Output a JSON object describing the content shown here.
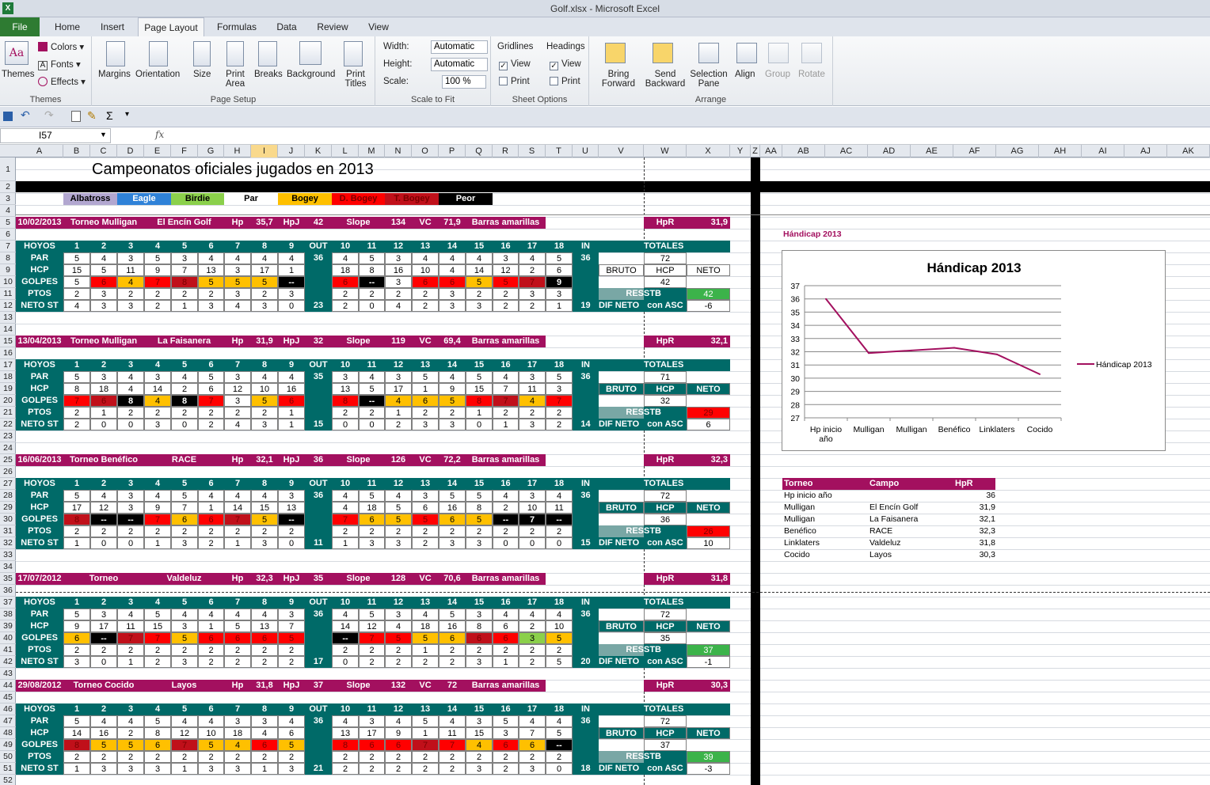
{
  "window": {
    "title": "Golf.xlsx  -  Microsoft Excel",
    "app_icon": "excel-icon"
  },
  "tabs": [
    "File",
    "Home",
    "Insert",
    "Page Layout",
    "Formulas",
    "Data",
    "Review",
    "View"
  ],
  "active_tab": "Page Layout",
  "ribbon": {
    "themes": {
      "label": "Themes",
      "colors": "Colors",
      "fonts": "Fonts",
      "effects": "Effects",
      "group": "Themes"
    },
    "page_setup": {
      "margins": "Margins",
      "orientation": "Orientation",
      "size": "Size",
      "print_area": "Print Area",
      "breaks": "Breaks",
      "background": "Background",
      "print_titles": "Print Titles",
      "group": "Page Setup"
    },
    "scale": {
      "width_label": "Width:",
      "width_value": "Automatic",
      "height_label": "Height:",
      "height_value": "Automatic",
      "scale_label": "Scale:",
      "scale_value": "100 %",
      "group": "Scale to Fit"
    },
    "sheet_options": {
      "gridlines": "Gridlines",
      "headings": "Headings",
      "view": "View",
      "print": "Print",
      "group": "Sheet Options"
    },
    "arrange": {
      "bring_forward": "Bring Forward",
      "send_backward": "Send Backward",
      "selection_pane": "Selection Pane",
      "align": "Align",
      "group_btn": "Group",
      "rotate": "Rotate",
      "group": "Arrange"
    }
  },
  "formula_bar": {
    "name_box": "I57",
    "fx": "fx",
    "formula": ""
  },
  "columns": [
    "A",
    "B",
    "C",
    "D",
    "E",
    "F",
    "G",
    "H",
    "I",
    "J",
    "K",
    "L",
    "M",
    "N",
    "O",
    "P",
    "Q",
    "R",
    "S",
    "T",
    "U",
    "V",
    "W",
    "X",
    "Y",
    "Z",
    "AA",
    "AB",
    "AC",
    "AD",
    "AE",
    "AF",
    "AG",
    "AH",
    "AI",
    "AJ",
    "AK"
  ],
  "selected_column": "I",
  "sheet": {
    "title": "Campeonatos oficiales jugados en 2013",
    "legend": [
      "Albatross",
      "Eagle",
      "Birdie",
      "Par",
      "Bogey",
      "D. Bogey",
      "T. Bogey",
      "Peor"
    ],
    "legend_colors": [
      "#b2a7d0",
      "#2f82d8",
      "#8bd04b",
      "#ffffff",
      "#ffc000",
      "#ff0000",
      "#c0101a",
      "#000000"
    ],
    "holes": [
      "1",
      "2",
      "3",
      "4",
      "5",
      "6",
      "7",
      "8",
      "9",
      "OUT",
      "10",
      "11",
      "12",
      "13",
      "14",
      "15",
      "16",
      "17",
      "18",
      "IN"
    ],
    "labels": {
      "hoyos": "HOYOS",
      "par": "PAR",
      "hcp": "HCP",
      "golpes": "GOLPES",
      "ptos": "PTOS",
      "neto": "NETO ST",
      "totales": "TOTALES",
      "bruto": "BRUTO",
      "hcp2": "HCP",
      "neto2": "NETO",
      "res": "RES",
      "stb": "STB",
      "dif": "DIF NETO",
      "asc": "con ASC",
      "hpr": "HpR",
      "hp": "Hp",
      "hpj": "HpJ",
      "slope": "Slope",
      "vc": "VC"
    },
    "rounds": [
      {
        "date": "10/02/2013",
        "event": "Torneo Mulligan",
        "course": "El Encín Golf",
        "hp": "35,7",
        "hpj": "42",
        "slope": "134",
        "vc": "71,9",
        "tees": "Barras amarillas",
        "hpr": "31,9",
        "par": [
          "5",
          "4",
          "3",
          "5",
          "3",
          "4",
          "4",
          "4",
          "4",
          "36",
          "4",
          "5",
          "3",
          "4",
          "4",
          "4",
          "3",
          "4",
          "5",
          "36"
        ],
        "par_total": "72",
        "hcp": [
          "15",
          "5",
          "11",
          "9",
          "7",
          "13",
          "3",
          "17",
          "1",
          "",
          "18",
          "8",
          "16",
          "10",
          "4",
          "14",
          "12",
          "2",
          "6",
          ""
        ],
        "golpes": [
          "5",
          "6",
          "4",
          "7",
          "8",
          "5",
          "5",
          "5",
          "--",
          "",
          "6",
          "--",
          "3",
          "6",
          "6",
          "5",
          "5",
          "7",
          "9",
          ""
        ],
        "golpes_c": [
          "p",
          "d",
          "b",
          "d",
          "t",
          "b",
          "b",
          "b",
          "k",
          "",
          "d",
          "k",
          "p",
          "d",
          "d",
          "b",
          "d",
          "t",
          "k",
          ""
        ],
        "bruto": "42",
        "ptos": [
          "2",
          "3",
          "2",
          "2",
          "2",
          "2",
          "3",
          "2",
          "3",
          "",
          "2",
          "2",
          "2",
          "2",
          "3",
          "2",
          "2",
          "3",
          "3",
          ""
        ],
        "stb": "42",
        "stb_c": "g",
        "neto": [
          "4",
          "3",
          "3",
          "2",
          "1",
          "3",
          "4",
          "3",
          "0",
          "23",
          "2",
          "0",
          "4",
          "2",
          "3",
          "3",
          "2",
          "2",
          "1",
          "19"
        ],
        "dif": "-6"
      },
      {
        "date": "13/04/2013",
        "event": "Torneo Mulligan",
        "course": "La Faisanera",
        "hp": "31,9",
        "hpj": "32",
        "slope": "119",
        "vc": "69,4",
        "tees": "Barras amarillas",
        "hpr": "32,1",
        "par": [
          "5",
          "3",
          "4",
          "3",
          "4",
          "5",
          "3",
          "4",
          "4",
          "35",
          "3",
          "4",
          "3",
          "5",
          "4",
          "5",
          "4",
          "3",
          "5",
          "36"
        ],
        "par_total": "71",
        "hcp": [
          "8",
          "18",
          "4",
          "14",
          "2",
          "6",
          "12",
          "10",
          "16",
          "",
          "13",
          "5",
          "17",
          "1",
          "9",
          "15",
          "7",
          "11",
          "3",
          ""
        ],
        "golpes": [
          "7",
          "6",
          "8",
          "4",
          "8",
          "7",
          "3",
          "5",
          "6",
          "",
          "8",
          "--",
          "4",
          "6",
          "5",
          "8",
          "7",
          "4",
          "7",
          ""
        ],
        "golpes_c": [
          "d",
          "t",
          "k",
          "b",
          "k",
          "d",
          "p",
          "b",
          "d",
          "",
          "d",
          "k",
          "b",
          "b",
          "b",
          "d",
          "t",
          "b",
          "d",
          ""
        ],
        "bruto": "32",
        "ptos": [
          "2",
          "1",
          "2",
          "2",
          "2",
          "2",
          "2",
          "2",
          "1",
          "",
          "2",
          "2",
          "1",
          "2",
          "2",
          "1",
          "2",
          "2",
          "2",
          ""
        ],
        "stb": "29",
        "stb_c": "r",
        "neto": [
          "2",
          "0",
          "0",
          "3",
          "0",
          "2",
          "4",
          "3",
          "1",
          "15",
          "0",
          "0",
          "2",
          "3",
          "3",
          "0",
          "1",
          "3",
          "2",
          "14"
        ],
        "dif": "6"
      },
      {
        "date": "16/06/2013",
        "event": "Torneo Benéfico",
        "course": "RACE",
        "hp": "32,1",
        "hpj": "36",
        "slope": "126",
        "vc": "72,2",
        "tees": "Barras amarillas",
        "hpr": "32,3",
        "par": [
          "5",
          "4",
          "3",
          "4",
          "5",
          "4",
          "4",
          "4",
          "3",
          "36",
          "4",
          "5",
          "4",
          "3",
          "5",
          "5",
          "4",
          "3",
          "4",
          "36"
        ],
        "par_total": "72",
        "hcp": [
          "17",
          "12",
          "3",
          "9",
          "7",
          "1",
          "14",
          "15",
          "13",
          "",
          "4",
          "18",
          "5",
          "6",
          "16",
          "8",
          "2",
          "10",
          "11",
          ""
        ],
        "golpes": [
          "8",
          "--",
          "--",
          "7",
          "6",
          "6",
          "7",
          "5",
          "--",
          "",
          "7",
          "6",
          "5",
          "5",
          "6",
          "5",
          "--",
          "7",
          "--",
          ""
        ],
        "golpes_c": [
          "t",
          "k",
          "k",
          "d",
          "b",
          "d",
          "t",
          "b",
          "k",
          "",
          "d",
          "b",
          "b",
          "d",
          "b",
          "b",
          "k",
          "k",
          "k",
          ""
        ],
        "bruto": "36",
        "ptos": [
          "2",
          "2",
          "2",
          "2",
          "2",
          "2",
          "2",
          "2",
          "2",
          "",
          "2",
          "2",
          "2",
          "2",
          "2",
          "2",
          "2",
          "2",
          "2",
          ""
        ],
        "stb": "26",
        "stb_c": "r",
        "neto": [
          "1",
          "0",
          "0",
          "1",
          "3",
          "2",
          "1",
          "3",
          "0",
          "11",
          "1",
          "3",
          "3",
          "2",
          "3",
          "3",
          "0",
          "0",
          "0",
          "15"
        ],
        "dif": "10"
      },
      {
        "date": "17/07/2012",
        "event": "Torneo",
        "course": "Valdeluz",
        "hp": "32,3",
        "hpj": "35",
        "slope": "128",
        "vc": "70,6",
        "tees": "Barras amarillas",
        "hpr": "31,8",
        "par": [
          "5",
          "3",
          "4",
          "5",
          "4",
          "4",
          "4",
          "4",
          "3",
          "36",
          "4",
          "5",
          "3",
          "4",
          "5",
          "3",
          "4",
          "4",
          "4",
          "36"
        ],
        "par_total": "72",
        "hcp": [
          "9",
          "17",
          "11",
          "15",
          "3",
          "1",
          "5",
          "13",
          "7",
          "",
          "14",
          "12",
          "4",
          "18",
          "16",
          "8",
          "6",
          "2",
          "10",
          ""
        ],
        "golpes": [
          "6",
          "--",
          "7",
          "7",
          "5",
          "6",
          "6",
          "6",
          "5",
          "",
          "--",
          "7",
          "5",
          "5",
          "6",
          "6",
          "6",
          "3",
          "5",
          ""
        ],
        "golpes_c": [
          "b",
          "k",
          "t",
          "d",
          "b",
          "d",
          "d",
          "d",
          "d",
          "",
          "k",
          "d",
          "d",
          "b",
          "b",
          "t",
          "d",
          "g",
          "b",
          ""
        ],
        "bruto": "35",
        "ptos": [
          "2",
          "2",
          "2",
          "2",
          "2",
          "2",
          "2",
          "2",
          "2",
          "",
          "2",
          "2",
          "2",
          "1",
          "2",
          "2",
          "2",
          "2",
          "2",
          ""
        ],
        "stb": "37",
        "stb_c": "g",
        "neto": [
          "3",
          "0",
          "1",
          "2",
          "3",
          "2",
          "2",
          "2",
          "2",
          "17",
          "0",
          "2",
          "2",
          "2",
          "2",
          "3",
          "1",
          "2",
          "5",
          "20"
        ],
        "dif": "-1"
      },
      {
        "date": "29/08/2012",
        "event": "Torneo Cocido",
        "course": "Layos",
        "hp": "31,8",
        "hpj": "37",
        "slope": "132",
        "vc": "72",
        "tees": "Barras amarillas",
        "hpr": "30,3",
        "par": [
          "5",
          "4",
          "4",
          "5",
          "4",
          "4",
          "3",
          "3",
          "4",
          "36",
          "4",
          "3",
          "4",
          "5",
          "4",
          "3",
          "5",
          "4",
          "4",
          "36"
        ],
        "par_total": "72",
        "hcp": [
          "14",
          "16",
          "2",
          "8",
          "12",
          "10",
          "18",
          "4",
          "6",
          "",
          "13",
          "17",
          "9",
          "1",
          "11",
          "15",
          "3",
          "7",
          "5",
          ""
        ],
        "golpes": [
          "8",
          "5",
          "5",
          "6",
          "7",
          "5",
          "4",
          "6",
          "5",
          "",
          "8",
          "6",
          "6",
          "7",
          "7",
          "4",
          "6",
          "6",
          "--",
          ""
        ],
        "golpes_c": [
          "t",
          "b",
          "b",
          "b",
          "t",
          "b",
          "b",
          "d",
          "b",
          "",
          "d",
          "d",
          "d",
          "t",
          "d",
          "b",
          "d",
          "b",
          "k",
          ""
        ],
        "bruto": "37",
        "ptos": [
          "2",
          "2",
          "2",
          "2",
          "2",
          "2",
          "2",
          "2",
          "2",
          "",
          "2",
          "2",
          "2",
          "2",
          "2",
          "2",
          "2",
          "2",
          "2",
          ""
        ],
        "stb": "39",
        "stb_c": "g",
        "neto": [
          "1",
          "3",
          "3",
          "3",
          "1",
          "3",
          "3",
          "1",
          "3",
          "21",
          "2",
          "2",
          "2",
          "2",
          "2",
          "3",
          "2",
          "3",
          "0",
          "18"
        ],
        "dif": "-3"
      }
    ],
    "handicap_label": "Hándicap 2013",
    "table": {
      "headers": [
        "Torneo",
        "Campo",
        "HpR"
      ],
      "rows": [
        [
          "Hp inicio año",
          "",
          "36"
        ],
        [
          "Mulligan",
          "El Encín Golf",
          "31,9"
        ],
        [
          "Mulligan",
          "La Faisanera",
          "32,1"
        ],
        [
          "Benéfico",
          "RACE",
          "32,3"
        ],
        [
          "Linklaters",
          "Valdeluz",
          "31,8"
        ],
        [
          "Cocido",
          "Layos",
          "30,3"
        ]
      ]
    }
  },
  "chart_data": {
    "type": "line",
    "title": "Hándicap  2013",
    "categories": [
      "Hp inicio año",
      "Mulligan",
      "Mulligan",
      "Benéfico",
      "Linklaters",
      "Cocido"
    ],
    "series": [
      {
        "name": "Hándicap 2013",
        "values": [
          36,
          31.9,
          32.1,
          32.3,
          31.8,
          30.3
        ],
        "color": "#a3105f"
      }
    ],
    "ylim": [
      27,
      37
    ],
    "yticks": [
      "27",
      "28",
      "29",
      "30",
      "31",
      "32",
      "33",
      "34",
      "35",
      "36",
      "37"
    ],
    "legend": "right",
    "grid": true
  }
}
